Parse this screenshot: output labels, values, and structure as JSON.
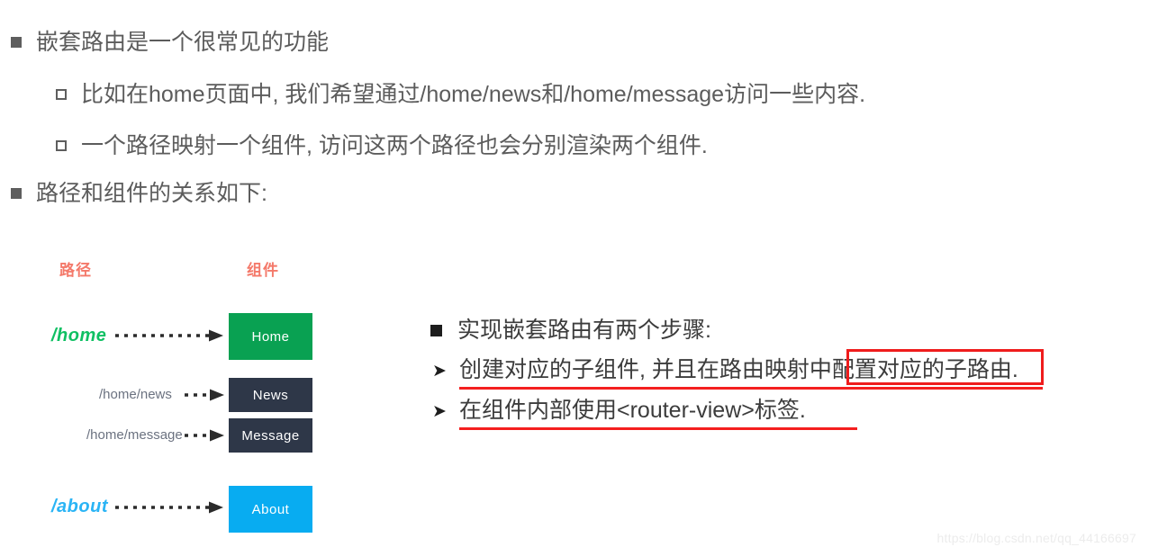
{
  "outline": {
    "items": [
      {
        "level": 1,
        "bullet": "filled-square",
        "text": "嵌套路由是一个很常见的功能"
      },
      {
        "level": 2,
        "bullet": "hollow-square",
        "text": "比如在home页面中, 我们希望通过/home/news和/home/message访问一些内容."
      },
      {
        "level": 2,
        "bullet": "hollow-square",
        "text": "一个路径映射一个组件, 访问这两个路径也会分别渲染两个组件."
      },
      {
        "level": 1,
        "bullet": "filled-square",
        "text": "路径和组件的关系如下:"
      }
    ]
  },
  "diagram": {
    "headers": {
      "path": "路径",
      "component": "组件",
      "color": "#f4796a"
    },
    "mappings": [
      {
        "path": "/home",
        "component": "Home",
        "box_color": "#09a152",
        "path_color": "#0fc063"
      },
      {
        "path": "/home/news",
        "component": "News",
        "box_color": "#2e3748",
        "path_color": "#6b7280"
      },
      {
        "path": "/home/message",
        "component": "Message",
        "box_color": "#2e3748",
        "path_color": "#6b7280"
      },
      {
        "path": "/about",
        "component": "About",
        "box_color": "#08acf1",
        "path_color": "#2ab4f5"
      }
    ]
  },
  "steps": {
    "heading": "实现嵌套路由有两个步骤:",
    "items": [
      {
        "bullet": "arrow",
        "text": "创建对应的子组件, 并且在路由映射中配置对应的子路由.",
        "underline": true
      },
      {
        "bullet": "arrow",
        "text": "在组件内部使用<router-view>标签.",
        "underline": true
      }
    ],
    "highlight": {
      "text": "配置对应的子路由.",
      "box_color": "#ef1c1c"
    },
    "underline_color": "#f41f1f"
  },
  "watermark": {
    "text": "https://blog.csdn.net/qq_44166697"
  }
}
